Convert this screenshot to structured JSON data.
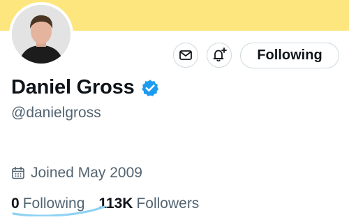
{
  "profile": {
    "display_name": "Daniel Gross",
    "handle": "@danielgross",
    "joined": "Joined May 2009",
    "verified": true
  },
  "actions": {
    "message_icon": "envelope-icon",
    "notify_icon": "bell-plus-icon",
    "follow_label": "Following"
  },
  "stats": {
    "following_count": "0",
    "following_label": "Following",
    "followers_count": "113K",
    "followers_label": "Followers"
  },
  "colors": {
    "banner": "#fde67d",
    "verified_badge": "#1d9bf0",
    "secondary_text": "#536471",
    "annotation_highlight": "#8fd3f5"
  }
}
